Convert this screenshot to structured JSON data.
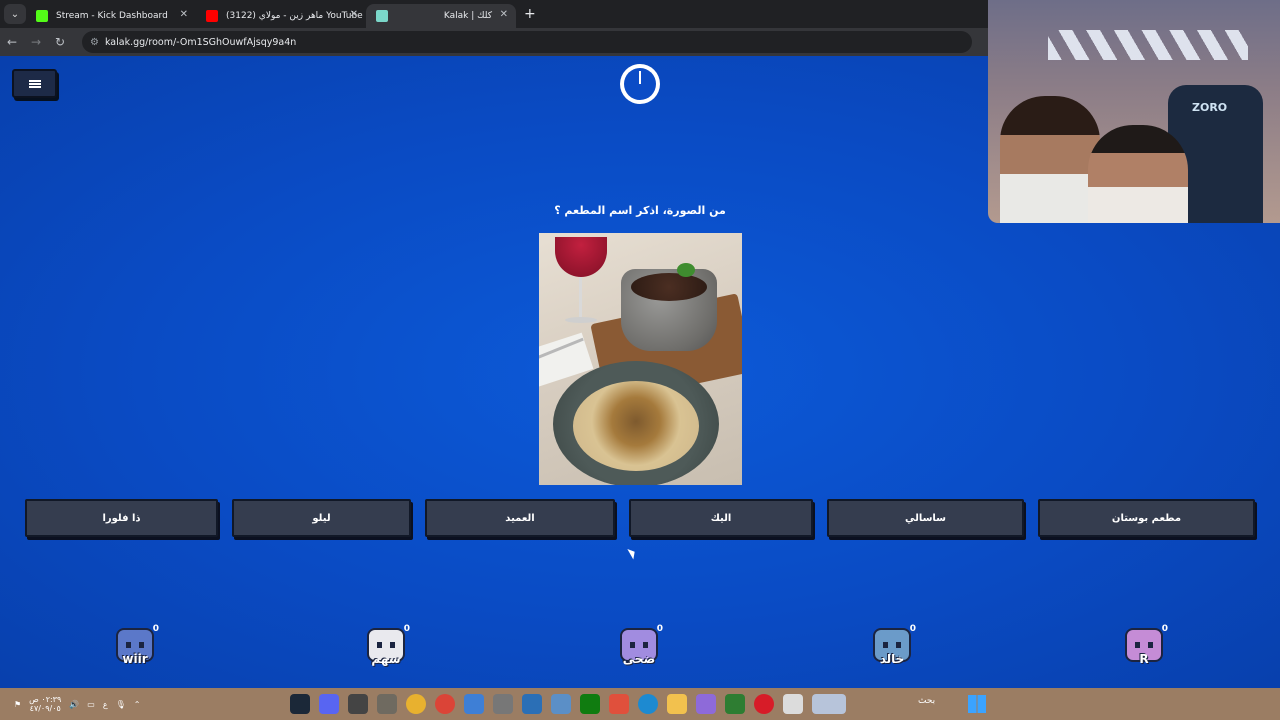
{
  "browser": {
    "tabs": [
      {
        "title": "Stream - Kick Dashboard",
        "favicon_color": "#53fc18",
        "active": false
      },
      {
        "title": "ماهر زين - مولاي (3122) YouTube",
        "favicon_color": "#ff0000",
        "active": false
      },
      {
        "title": "Kalak | كلك",
        "favicon_color": "#7bd7c9",
        "active": true
      }
    ],
    "new_tab": "+",
    "url": "kalak.gg/room/-Om1SGhOuwfAjsqy9a4n"
  },
  "game": {
    "question": "من الصورة، اذكر اسم المطعم ؟",
    "answers": [
      "ذا فلورا",
      "ليلو",
      "العميد",
      "اليك",
      "ساسالي",
      "مطعم بوستان"
    ],
    "players": [
      {
        "name": "wiir",
        "score": "0",
        "color": "#5b78c9"
      },
      {
        "name": "سهم",
        "score": "0",
        "color": "#e9e9ee"
      },
      {
        "name": "ضحى",
        "score": "0",
        "color": "#a18ce0"
      },
      {
        "name": "خالد",
        "score": "0",
        "color": "#6b9bc9"
      },
      {
        "name": "R",
        "score": "0",
        "color": "#c58cd6"
      }
    ]
  },
  "webcam": {
    "chair_brand": "ZORO"
  },
  "taskbar": {
    "clock_time": "٠٢:٣٩ ص",
    "clock_date": "٤٧/٠٩/٠٥",
    "lang": "ع",
    "search_label": "بحث"
  },
  "colors": {
    "page_bg": "#0b4fcf",
    "button_bg": "#353d4f",
    "taskbar_bg": "#9b7d63"
  }
}
